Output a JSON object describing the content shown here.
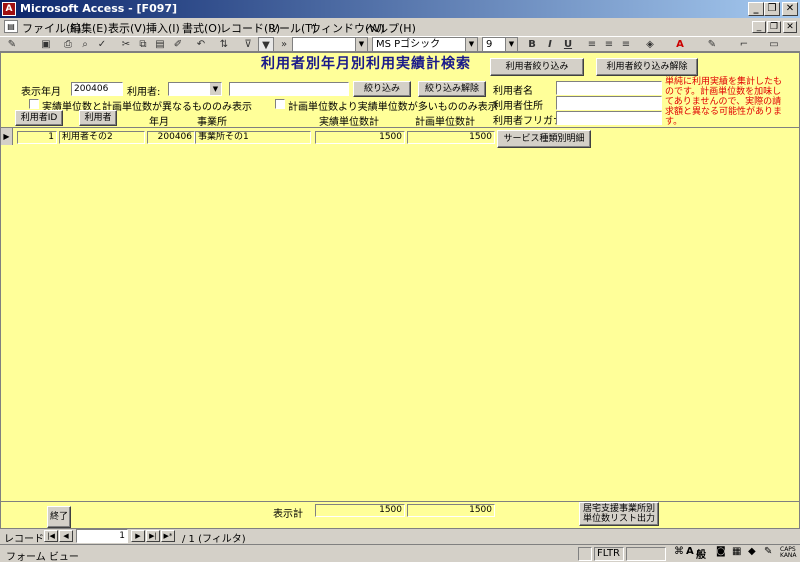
{
  "window": {
    "title": "Microsoft Access - [F097]",
    "minimize": "_",
    "restore": "❐",
    "close": "✕"
  },
  "menu": {
    "items": [
      "ファイル(F)",
      "編集(E)",
      "表示(V)",
      "挿入(I)",
      "書式(O)",
      "レコード(R)",
      "ツール(T)",
      "ウィンドウ(W)",
      "ヘルプ(H)"
    ]
  },
  "toolbar": {
    "object_combo": "",
    "font_name": "MS Pゴシック",
    "font_size": "9",
    "bold": "B",
    "italic": "I",
    "underline": "U"
  },
  "form": {
    "heading": "利用者別年月別利用実績計検索",
    "display_month_label": "表示年月",
    "display_month_value": "200406",
    "user_label": "利用者:",
    "user_value": "",
    "user_name_value": "",
    "filter_button": "絞り込み",
    "clear_filter_button": "絞り込み解除",
    "user_filter_button": "利用者絞り込み",
    "user_filter_clear_button": "利用者絞り込み解除",
    "user_name_label": "利用者名",
    "user_address_label": "利用者住所",
    "user_kana_label": "利用者フリガナ",
    "note": "単純に利用実績を集計したものです。計画単位数を加味してありませんので、実際の請求額と異なる可能性があります。",
    "check1_label": "実績単位数と計画単位数が異なるもののみ表示",
    "check2_label": "計画単位数より実績単位数が多いもののみ表示",
    "col_user_id_button": "利用者ID",
    "col_user_button": "利用者",
    "col_month": "年月",
    "col_office": "事業所",
    "col_actual": "実績単位数計",
    "col_plan": "計画単位数計",
    "rows": [
      {
        "id": "1",
        "user": "利用者その2",
        "month": "200406",
        "office": "事業所その1",
        "actual": "1500",
        "plan": "1500",
        "detail_button": "サービス種類別明細"
      }
    ],
    "end_button": "終了",
    "total_label": "表示計",
    "total_actual": "1500",
    "total_plan": "1500",
    "report_button": "居宅支援事業所別\n単位数リスト出力"
  },
  "recnav": {
    "label": "レコード:",
    "current": "1",
    "total": "/ 1 (フィルタ)"
  },
  "status": {
    "view": "フォーム ビュー",
    "fltr": "FLTR",
    "ime_a": "A",
    "ime_mode": "般",
    "caps": "CAPS KANA"
  },
  "colors": {
    "form_bg": "#ffff99",
    "heading": "#1a1a8a",
    "note": "#e00000"
  }
}
